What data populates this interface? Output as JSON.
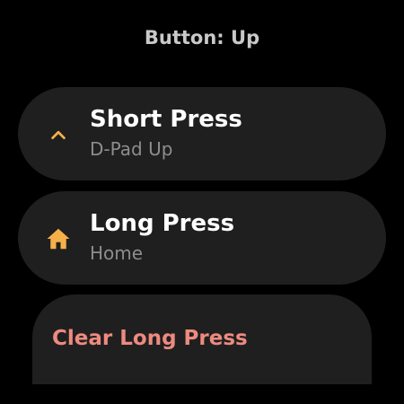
{
  "header": {
    "title": "Button: Up"
  },
  "short_press": {
    "label": "Short Press",
    "value": "D-Pad Up",
    "icon": "chevron-up-icon"
  },
  "long_press": {
    "label": "Long Press",
    "value": "Home",
    "icon": "home-icon"
  },
  "clear": {
    "label": "Clear Long Press"
  },
  "colors": {
    "background": "#000000",
    "chip": "#1f1f1f",
    "accent_icon": "#f6b04a",
    "clear_text": "#ee8a80",
    "primary_text": "#ffffff",
    "secondary_text": "#8d8d8d",
    "title_text": "#c9c9c9"
  }
}
